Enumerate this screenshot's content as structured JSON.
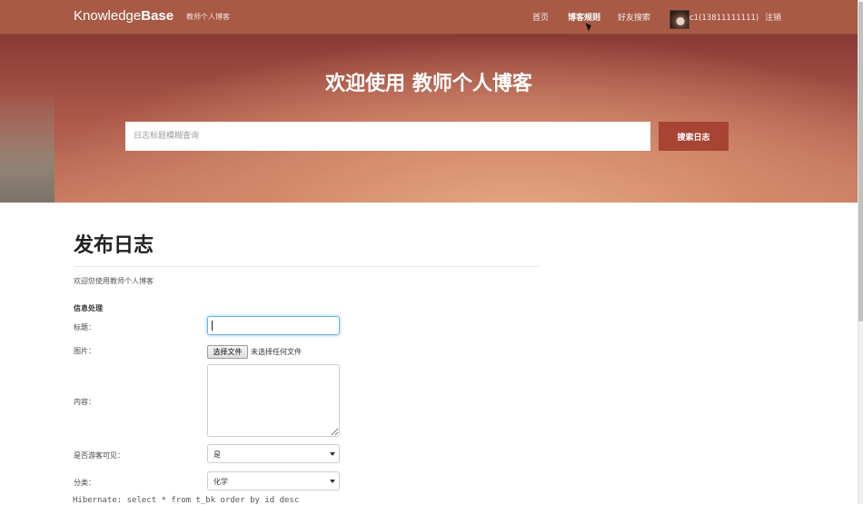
{
  "navbar": {
    "brand_light": "Knowledge",
    "brand_bold": "Base",
    "brand_sub": "教师个人博客",
    "links": [
      "首页",
      "博客规则",
      "好友搜索"
    ],
    "user_label": "c1(13811111111)",
    "logout": "注销"
  },
  "hero": {
    "title": "欢迎使用 教师个人博客",
    "search_placeholder": "日志标题模糊查询",
    "search_button": "搜索日志"
  },
  "form": {
    "page_title": "发布日志",
    "intro": "欢迎您使用教师个人博客",
    "section": "信息处理",
    "title_label": "标题：",
    "image_label": "图片：",
    "file_button": "选择文件",
    "file_status": "未选择任何文件",
    "content_label": "内容：",
    "visible_label": "是否游客可见：",
    "visible_value": "是",
    "category_label": "分类：",
    "category_value": "化学"
  },
  "console_text": "Hibernate: select * from t_bk order by id desc",
  "colors": {
    "navbar": "#a85a45",
    "search_button": "#a84433",
    "focus": "#66afe9"
  }
}
